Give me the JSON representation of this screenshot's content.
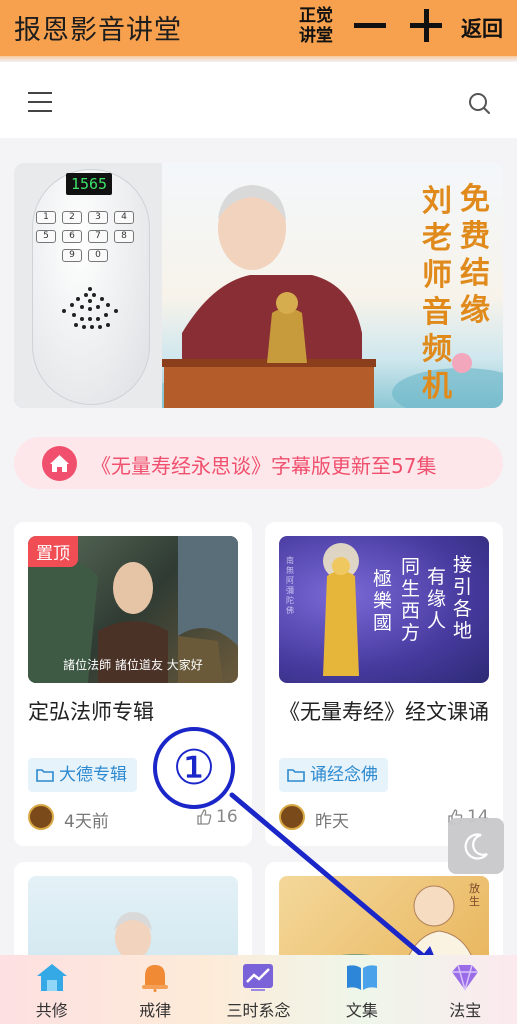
{
  "topbar": {
    "title": "报恩影音讲堂",
    "stack_line1": "正觉",
    "stack_line2": "讲堂",
    "back_label": "返回"
  },
  "banner": {
    "device_display": "1565",
    "device_keys": [
      "1",
      "2",
      "3",
      "4",
      "5",
      "6",
      "7",
      "8",
      "9",
      "0"
    ],
    "vertical_col1": "免费结缘",
    "vertical_col2": "刘老师音频机"
  },
  "notice": {
    "text": "《无量寿经永思谈》字幕版更新至57集"
  },
  "cards": [
    {
      "pin": "置顶",
      "subtitle": "諸位法師 諸位道友 大家好",
      "title": "定弘法师专辑",
      "tag": "大德专辑",
      "time": "4天前",
      "likes": "16"
    },
    {
      "poem": [
        "接引各地",
        "有缘人",
        "同生西方",
        "極樂國"
      ],
      "side_text": "南無阿彌陀佛",
      "title": "《无量寿经》经文课诵",
      "tag": "诵经念佛",
      "time": "昨天",
      "likes": "14"
    }
  ],
  "bottom_card_corner": "放生",
  "annotation": {
    "marker": "①"
  },
  "tabs": [
    {
      "label": "共修",
      "icon": "house-icon",
      "color": "#35a9e6"
    },
    {
      "label": "戒律",
      "icon": "bell-icon",
      "color": "#f08a35"
    },
    {
      "label": "三时系念",
      "icon": "trend-chart-icon",
      "color": "#7a63d9"
    },
    {
      "label": "文集",
      "icon": "book-icon",
      "color": "#2e86d8"
    },
    {
      "label": "法宝",
      "icon": "diamond-icon",
      "color": "#9b6ce8"
    }
  ]
}
